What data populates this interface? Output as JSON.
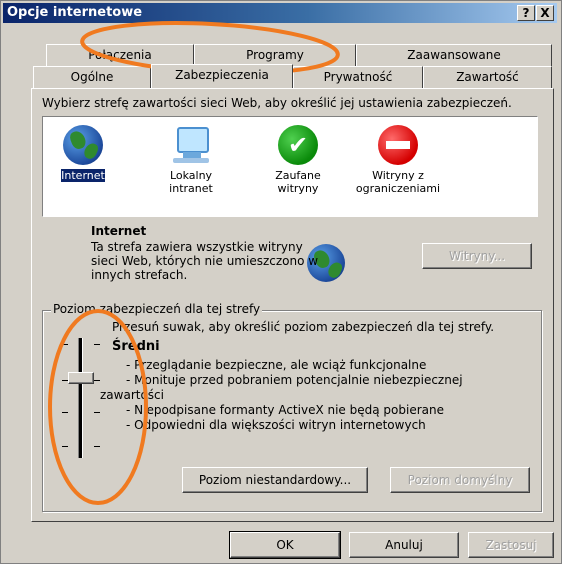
{
  "window": {
    "title": "Opcje internetowe",
    "help_button": "?",
    "close_button": "X"
  },
  "tabs": {
    "row_back": [
      "Połączenia",
      "Programy",
      "Zaawansowane"
    ],
    "row_front": [
      "Ogólne",
      "Zabezpieczenia",
      "Prywatność",
      "Zawartość"
    ],
    "active": "Zabezpieczenia"
  },
  "zones": {
    "prompt": "Wybierz strefę zawartości sieci Web, aby określić jej ustawienia zabezpieczeń.",
    "items": [
      {
        "label": "Internet",
        "icon": "globe-icon",
        "selected": true
      },
      {
        "label_1": "Lokalny",
        "label_2": "intranet",
        "icon": "local-intranet-icon"
      },
      {
        "label_1": "Zaufane",
        "label_2": "witryny",
        "icon": "trusted-sites-icon"
      },
      {
        "label_1": "Witryny z",
        "label_2": "ograniczeniami",
        "icon": "restricted-sites-icon"
      }
    ]
  },
  "zone_info": {
    "name": "Internet",
    "description_1": "Ta strefa zawiera wszystkie witryny",
    "description_2": "sieci Web, których nie umieszczono w",
    "description_3": "innych strefach.",
    "sites_button": "Witryny..."
  },
  "security_level": {
    "group_title": "Poziom zabezpieczeń dla tej strefy",
    "instruction": "Przesuń suwak, aby określić poziom zabezpieczeń dla tej strefy.",
    "level_name": "Średni",
    "bullets": [
      "- Przeglądanie bezpieczne, ale wciąż funkcjonalne",
      "- Monituje przed pobraniem potencjalnie niebezpiecznej",
      "zawartości",
      "- Niepodpisane formanty ActiveX nie będą pobierane",
      "- Odpowiedni dla większości witryn internetowych"
    ],
    "slider_level": "2 of 4",
    "custom_button": "Poziom niestandardowy...",
    "default_button": "Poziom domyślny"
  },
  "footer": {
    "ok": "OK",
    "cancel": "Anuluj",
    "apply": "Zastosuj"
  },
  "colors": {
    "annotation": "#f07a20",
    "titlebar": "#0a246a",
    "selection": "#0a246a"
  }
}
